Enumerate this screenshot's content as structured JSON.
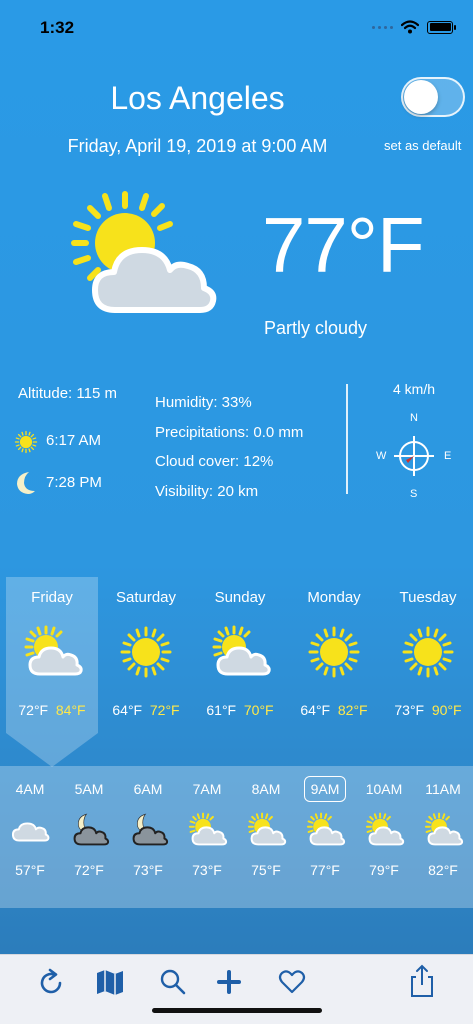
{
  "status": {
    "time": "1:32"
  },
  "header": {
    "city": "Los Angeles",
    "datetime": "Friday, April 19, 2019 at 9:00 AM",
    "default_label": "set as default"
  },
  "current": {
    "temperature": "77°F",
    "condition": "Partly cloudy",
    "altitude": "Altitude: 115 m",
    "sunrise": "6:17 AM",
    "sunset": "7:28 PM"
  },
  "details": {
    "humidity": "Humidity: 33%",
    "precipitations": "Precipitations: 0.0 mm",
    "cloud_cover": "Cloud cover: 12%",
    "visibility": "Visibility: 20 km"
  },
  "wind": {
    "speed": "4 km/h",
    "n": "N",
    "e": "E",
    "s": "S",
    "w": "W"
  },
  "daily": [
    {
      "day": "Friday",
      "low": "72°F",
      "high": "84°F",
      "icon": "partly-cloudy-icon"
    },
    {
      "day": "Saturday",
      "low": "64°F",
      "high": "72°F",
      "icon": "sun-icon"
    },
    {
      "day": "Sunday",
      "low": "61°F",
      "high": "70°F",
      "icon": "partly-cloudy-icon"
    },
    {
      "day": "Monday",
      "low": "64°F",
      "high": "82°F",
      "icon": "sun-icon"
    },
    {
      "day": "Tuesday",
      "low": "73°F",
      "high": "90°F",
      "icon": "sun-icon"
    }
  ],
  "hourly": [
    {
      "time": "4AM",
      "temp": "57°F",
      "icon": "cloud-icon"
    },
    {
      "time": "5AM",
      "temp": "72°F",
      "icon": "moon-cloud-icon"
    },
    {
      "time": "6AM",
      "temp": "73°F",
      "icon": "moon-cloud-icon"
    },
    {
      "time": "7AM",
      "temp": "73°F",
      "icon": "partly-cloudy-icon"
    },
    {
      "time": "8AM",
      "temp": "75°F",
      "icon": "partly-cloudy-icon"
    },
    {
      "time": "9AM",
      "temp": "77°F",
      "icon": "partly-cloudy-icon",
      "selected": true
    },
    {
      "time": "10AM",
      "temp": "79°F",
      "icon": "partly-cloudy-icon"
    },
    {
      "time": "11AM",
      "temp": "82°F",
      "icon": "partly-cloudy-icon"
    }
  ],
  "colors": {
    "sun": "#f7e21b",
    "high_temp": "#ffe94a",
    "cloud": "#cfd9e2",
    "toolbar_icon": "#1f5fa8"
  }
}
